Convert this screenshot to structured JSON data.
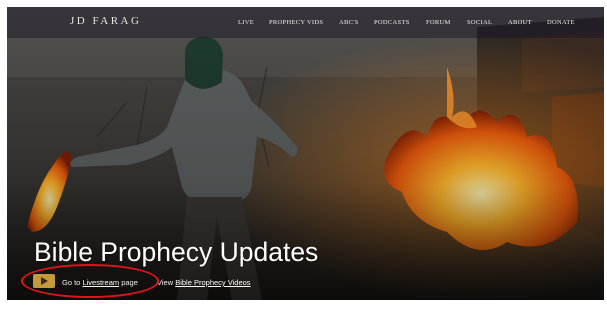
{
  "site": {
    "brand": "JD FARAG"
  },
  "nav": {
    "items": [
      {
        "label": "LIVE"
      },
      {
        "label": "PROPHECY VIDS"
      },
      {
        "label": "ABC'S"
      },
      {
        "label": "PODCASTS"
      },
      {
        "label": "FORUM"
      },
      {
        "label": "SOCIAL"
      },
      {
        "label": "ABOUT"
      },
      {
        "label": "DONATE"
      }
    ]
  },
  "hero": {
    "title": "Bible Prophecy Updates",
    "youtube_icon": "youtube-play-icon",
    "livestream_prefix": "Go to ",
    "livestream_link": "Livestream",
    "livestream_suffix": " page",
    "videos_prefix": "View ",
    "videos_link": "Bible Prophecy Videos"
  },
  "colors": {
    "accent_gold": "#c49a3a",
    "annotation_red": "#e0141b",
    "nav_text": "#f0ece6"
  }
}
